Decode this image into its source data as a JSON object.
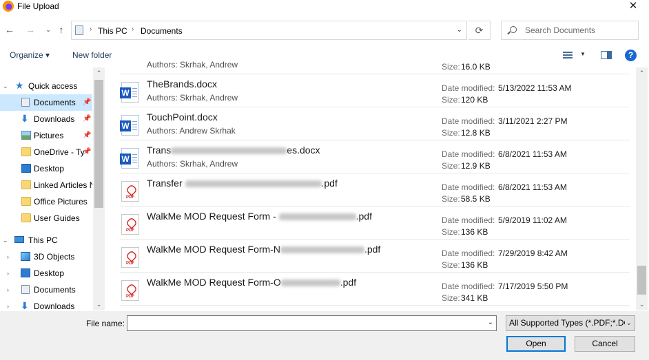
{
  "window": {
    "title": "File Upload",
    "close_label": "✕"
  },
  "address": {
    "crumbs": [
      "This PC",
      "Documents"
    ],
    "search_placeholder": "Search Documents"
  },
  "toolbar": {
    "organize": "Organize ▾",
    "new_folder": "New folder",
    "help": "?"
  },
  "nav": {
    "quick_access": "Quick access",
    "quick_items": [
      {
        "label": "Documents",
        "icon": "documents-icon",
        "pinned": true
      },
      {
        "label": "Downloads",
        "icon": "download-arrow-icon",
        "pinned": true
      },
      {
        "label": "Pictures",
        "icon": "pictures-icon",
        "pinned": true
      },
      {
        "label": "OneDrive - Ty",
        "icon": "folder-icon",
        "pinned": true
      },
      {
        "label": "Desktop",
        "icon": "desktop-icon",
        "pinned": false
      },
      {
        "label": "Linked Articles N",
        "icon": "folder-icon",
        "pinned": false
      },
      {
        "label": "Office Pictures",
        "icon": "folder-icon",
        "pinned": false
      },
      {
        "label": "User Guides",
        "icon": "folder-icon",
        "pinned": false
      }
    ],
    "this_pc": "This PC",
    "pc_items": [
      {
        "label": "3D Objects",
        "icon": "3d-objects-icon"
      },
      {
        "label": "Desktop",
        "icon": "desktop-icon"
      },
      {
        "label": "Documents",
        "icon": "documents-icon"
      },
      {
        "label": "Downloads",
        "icon": "download-arrow-icon"
      }
    ]
  },
  "labels": {
    "authors": "Authors:",
    "date_modified": "Date modified:",
    "size": "Size:"
  },
  "files": [
    {
      "name": "",
      "type": "partial",
      "authors": "Skrhak, Andrew",
      "date": "",
      "size": "16.0 KB"
    },
    {
      "name": "TheBrands.docx",
      "type": "word",
      "authors": "Skrhak, Andrew",
      "date": "5/13/2022 11:53 AM",
      "size": "120 KB"
    },
    {
      "name": "TouchPoint.docx",
      "type": "word",
      "authors": "Andrew Skrhak",
      "date": "3/11/2021 2:27 PM",
      "size": "12.8 KB"
    },
    {
      "name_start": "Trans",
      "name_end": "es.docx",
      "type": "word",
      "authors": "Skrhak, Andrew",
      "date": "6/8/2021 11:53 AM",
      "size": "12.9 KB"
    },
    {
      "name_start": "Transfer ",
      "name_end": ".pdf",
      "type": "pdf",
      "date": "6/8/2021 11:53 AM",
      "size": "58.5 KB"
    },
    {
      "name_start": "WalkMe  MOD Request Form - ",
      "name_end": ".pdf",
      "type": "pdf",
      "date": "5/9/2019 11:02 AM",
      "size": "136 KB"
    },
    {
      "name_start": "WalkMe  MOD Request Form-N",
      "name_end": ".pdf",
      "type": "pdf",
      "date": "7/29/2019 8:42 AM",
      "size": "136 KB"
    },
    {
      "name_start": "WalkMe  MOD Request Form-O",
      "name_end": ".pdf",
      "type": "pdf",
      "date": "7/17/2019 5:50 PM",
      "size": "341 KB"
    }
  ],
  "bottom": {
    "file_name_label": "File name:",
    "file_name_value": "",
    "file_type": "All Supported Types (*.PDF;*.DC",
    "open": "Open",
    "cancel": "Cancel"
  },
  "colors": {
    "selection": "#cce8ff",
    "accent": "#0078d7",
    "word": "#185abd",
    "pdf": "#d8231f"
  }
}
